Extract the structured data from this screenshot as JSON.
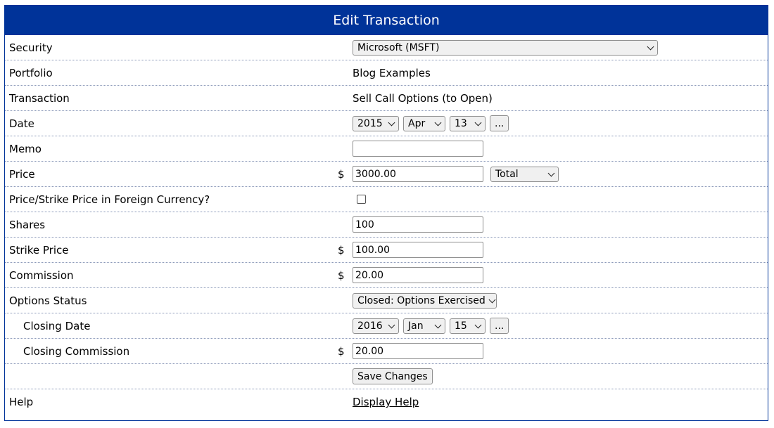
{
  "window": {
    "title": "Edit Transaction"
  },
  "form": {
    "security": {
      "label": "Security",
      "selected": "Microsoft (MSFT)"
    },
    "portfolio": {
      "label": "Portfolio",
      "value": "Blog Examples"
    },
    "transaction": {
      "label": "Transaction",
      "value": "Sell Call Options (to Open)"
    },
    "date": {
      "label": "Date",
      "year": "2015",
      "month": "Apr",
      "day": "13",
      "picker": "..."
    },
    "memo": {
      "label": "Memo",
      "value": ""
    },
    "price": {
      "label": "Price",
      "currency": "$",
      "value": "3000.00",
      "type": "Total"
    },
    "foreign_currency": {
      "label": "Price/Strike Price in Foreign Currency?",
      "checked": false
    },
    "shares": {
      "label": "Shares",
      "value": "100"
    },
    "strike_price": {
      "label": "Strike Price",
      "currency": "$",
      "value": "100.00"
    },
    "commission": {
      "label": "Commission",
      "currency": "$",
      "value": "20.00"
    },
    "options_status": {
      "label": "Options Status",
      "selected": "Closed: Options Exercised"
    },
    "closing_date": {
      "label": "Closing Date",
      "year": "2016",
      "month": "Jan",
      "day": "15",
      "picker": "..."
    },
    "closing_commission": {
      "label": "Closing Commission",
      "currency": "$",
      "value": "20.00"
    },
    "save_label": "Save Changes",
    "help": {
      "label": "Help",
      "link": "Display Help"
    }
  }
}
